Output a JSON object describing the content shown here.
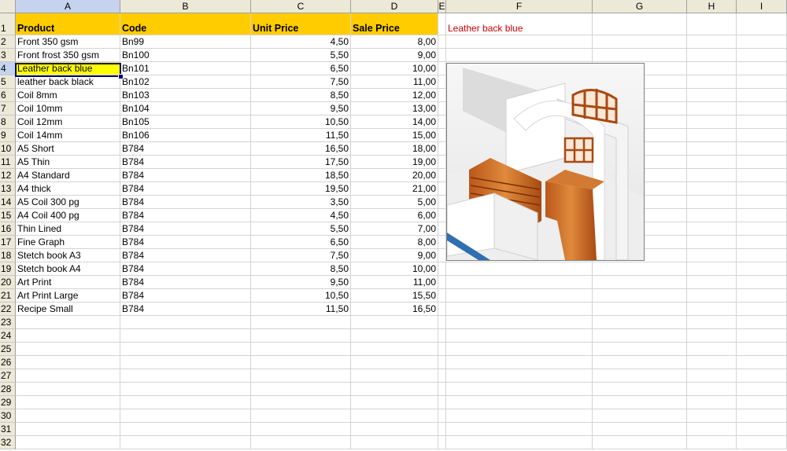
{
  "columns": [
    "A",
    "B",
    "C",
    "D",
    "E",
    "F",
    "G",
    "H",
    "I"
  ],
  "selected_column": "A",
  "selected_row": 4,
  "row_numbers": [
    1,
    2,
    3,
    4,
    5,
    6,
    7,
    8,
    9,
    10,
    11,
    12,
    13,
    14,
    15,
    16,
    17,
    18,
    19,
    20,
    21,
    22,
    23,
    24,
    25,
    26,
    27,
    28,
    29,
    30,
    31,
    32
  ],
  "headers": {
    "product": "Product",
    "code": "Code",
    "unit_price": "Unit Price",
    "sale_price": "Sale Price"
  },
  "lookup_result": "Leather back blue",
  "rows": [
    {
      "product": "Front 350 gsm",
      "code": "Bn99",
      "unit_price": "4,50",
      "sale_price": "8,00"
    },
    {
      "product": "Front frost 350 gsm",
      "code": "Bn100",
      "unit_price": "5,50",
      "sale_price": "9,00"
    },
    {
      "product": "Leather back blue",
      "code": "Bn101",
      "unit_price": "6,50",
      "sale_price": "10,00"
    },
    {
      "product": "leather back black",
      "code": "Bn102",
      "unit_price": "7,50",
      "sale_price": "11,00"
    },
    {
      "product": "Coil 8mm",
      "code": "Bn103",
      "unit_price": "8,50",
      "sale_price": "12,00"
    },
    {
      "product": "Coil 10mm",
      "code": "Bn104",
      "unit_price": "9,50",
      "sale_price": "13,00"
    },
    {
      "product": "Coil 12mm",
      "code": "Bn105",
      "unit_price": "10,50",
      "sale_price": "14,00"
    },
    {
      "product": "Coil 14mm",
      "code": "Bn106",
      "unit_price": "11,50",
      "sale_price": "15,00"
    },
    {
      "product": "A5 Short",
      "code": "B784",
      "unit_price": "16,50",
      "sale_price": "18,00"
    },
    {
      "product": "A5 Thin",
      "code": "B784",
      "unit_price": "17,50",
      "sale_price": "19,00"
    },
    {
      "product": "A4 Standard",
      "code": "B784",
      "unit_price": "18,50",
      "sale_price": "20,00"
    },
    {
      "product": "A4 thick",
      "code": "B784",
      "unit_price": "19,50",
      "sale_price": "21,00"
    },
    {
      "product": "A5 Coil 300 pg",
      "code": "B784",
      "unit_price": "3,50",
      "sale_price": "5,00"
    },
    {
      "product": "A4 Coil 400 pg",
      "code": "B784",
      "unit_price": "4,50",
      "sale_price": "6,00"
    },
    {
      "product": "Thin Lined",
      "code": "B784",
      "unit_price": "5,50",
      "sale_price": "7,00"
    },
    {
      "product": "Fine Graph",
      "code": "B784",
      "unit_price": "6,50",
      "sale_price": "8,00"
    },
    {
      "product": "Stetch book A3",
      "code": "B784",
      "unit_price": "7,50",
      "sale_price": "9,00"
    },
    {
      "product": "Stetch book A4",
      "code": "B784",
      "unit_price": "8,50",
      "sale_price": "10,00"
    },
    {
      "product": "Art Print",
      "code": "B784",
      "unit_price": "9,50",
      "sale_price": "11,00"
    },
    {
      "product": "Art Print  Large",
      "code": "B784",
      "unit_price": "10,50",
      "sale_price": "15,50"
    },
    {
      "product": "Recipe Small",
      "code": "B784",
      "unit_price": "11,50",
      "sale_price": "16,50"
    }
  ],
  "colors": {
    "header_fill": "#ffcc00",
    "highlight_fill": "#ffff00",
    "lookup_text": "#cc0000",
    "selection_border": "#000080"
  }
}
